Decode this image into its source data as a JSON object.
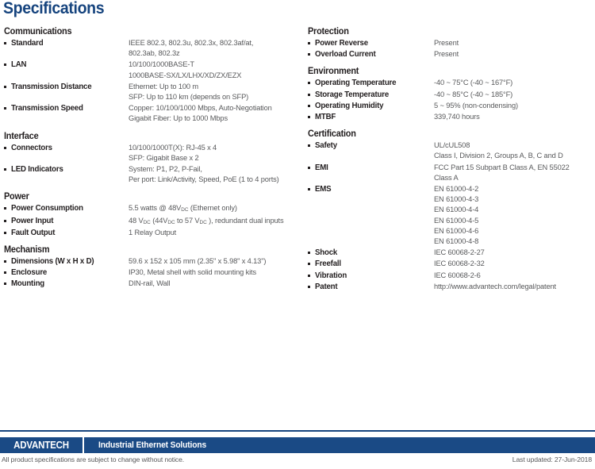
{
  "page": {
    "title": "Specifications"
  },
  "columns": {
    "left": [
      {
        "title": "Communications",
        "rows": [
          {
            "label": "Standard",
            "value": "IEEE 802.3, 802.3u, 802.3x, 802.3af/at,\n802.3ab, 802.3z"
          },
          {
            "label": "LAN",
            "value": "10/100/1000BASE-T\n1000BASE-SX/LX/LHX/XD/ZX/EZX"
          },
          {
            "label": "Transmission Distance",
            "value": "Ethernet: Up to 100 m\nSFP: Up to 110 km (depends on SFP)"
          },
          {
            "label": "Transmission Speed",
            "value": "Copper: 10/100/1000 Mbps, Auto-Negotiation\nGigabit Fiber: Up to 1000 Mbps"
          }
        ]
      },
      {
        "title": "Interface",
        "rows": [
          {
            "label": "Connectors",
            "value": "10/100/1000T(X): RJ-45 x 4\nSFP: Gigabit Base x 2"
          },
          {
            "label": "LED Indicators",
            "value": "System: P1, P2, P-Fail,\nPer port: Link/Activity, Speed, PoE (1 to 4 ports)"
          }
        ]
      },
      {
        "title": "Power",
        "rows": [
          {
            "label": "Power Consumption",
            "value_html": "5.5 watts @ 48V<sub>DC</sub>  (Ethernet only)"
          },
          {
            "label": "Power Input",
            "value_html": "48 V<sub>DC</sub> (44V<sub>DC</sub> to 57 V<sub>DC</sub> ), redundant dual inputs"
          },
          {
            "label": "Fault Output",
            "value": "1 Relay Output"
          }
        ]
      },
      {
        "title": "Mechanism",
        "rows": [
          {
            "label": "Dimensions (W x H x D)",
            "value": "59.6 x 152 x 105 mm (2.35\" x 5.98\" x 4.13\")"
          },
          {
            "label": "Enclosure",
            "value": "IP30, Metal shell with solid mounting kits"
          },
          {
            "label": "Mounting",
            "value": "DIN-rail, Wall"
          }
        ]
      }
    ],
    "right": [
      {
        "title": "Protection",
        "rows": [
          {
            "label": "Power Reverse",
            "value": "Present"
          },
          {
            "label": "Overload Current",
            "value": "Present"
          }
        ]
      },
      {
        "title": "Environment",
        "rows": [
          {
            "label": "Operating Temperature",
            "value": "-40 ~ 75°C  (-40 ~ 167°F)"
          },
          {
            "label": "Storage Temperature",
            "value": "-40 ~ 85°C  (-40 ~ 185°F)"
          },
          {
            "label": "Operating Humidity",
            "value": "5 ~ 95% (non-condensing)"
          },
          {
            "label": "MTBF",
            "value": "339,740 hours"
          }
        ]
      },
      {
        "title": "Certification",
        "rows": [
          {
            "label": "Safety",
            "value": "UL/cUL508\nClass I, Division 2, Groups A, B, C and D"
          },
          {
            "label": "EMI",
            "value": "FCC Part 15 Subpart B Class A,  EN 55022\nClass A"
          },
          {
            "label": "EMS",
            "value": "EN 61000-4-2\nEN 61000-4-3\nEN 61000-4-4\nEN 61000-4-5\nEN 61000-4-6\nEN 61000-4-8"
          },
          {
            "label": "Shock",
            "value": "IEC 60068-2-27"
          },
          {
            "label": "Freefall",
            "value": "IEC 60068-2-32"
          },
          {
            "label": "Vibration",
            "value": "IEC 60068-2-6"
          },
          {
            "label": "Patent",
            "value": "http://www.advantech.com/legal/patent"
          }
        ]
      }
    ]
  },
  "footer": {
    "logo": "ADVANTECH",
    "tagline": "Industrial Ethernet Solutions",
    "note": "All product specifications are subject to change without notice.",
    "updated": "Last updated: 27-Jun-2018"
  },
  "colors": {
    "title_blue": "#16447e",
    "footer_bar": "#1a4a85",
    "body_text": "#231f20",
    "value_text": "#58595b"
  }
}
